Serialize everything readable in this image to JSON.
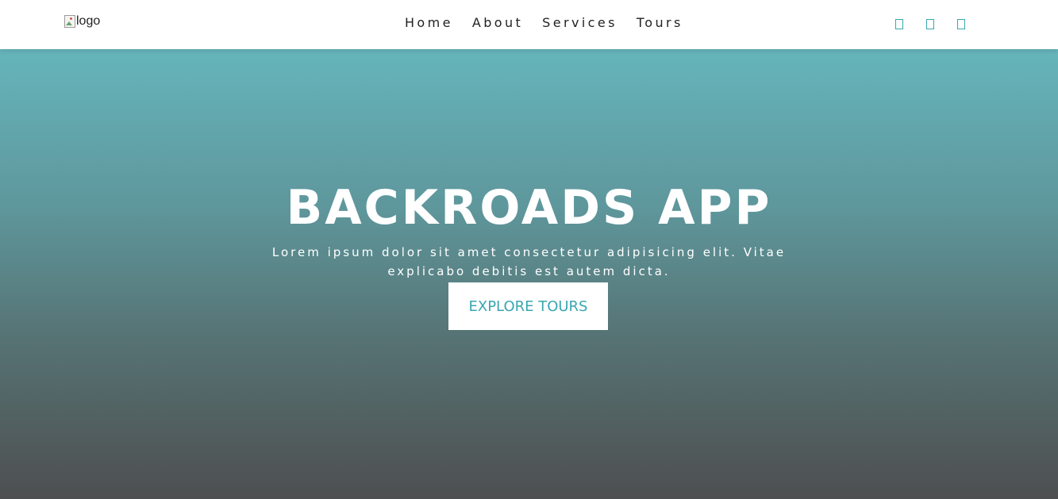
{
  "header": {
    "logo_alt": "logo",
    "nav": [
      {
        "label": "Home"
      },
      {
        "label": "About"
      },
      {
        "label": "Services"
      },
      {
        "label": "Tours"
      }
    ],
    "social_icons": [
      "facebook-icon",
      "twitter-icon",
      "squarespace-icon"
    ]
  },
  "hero": {
    "title": "BACKROADS APP",
    "text": "Lorem ipsum dolor sit amet consectetur adipisicing elit. Vitae explicabo debitis est autem dicta.",
    "button_label": "EXPLORE TOURS"
  },
  "colors": {
    "accent": "#3aa6b0",
    "hero_top": "#65b5bb",
    "hero_bottom": "#4e4f50",
    "nav_text": "#222222"
  }
}
